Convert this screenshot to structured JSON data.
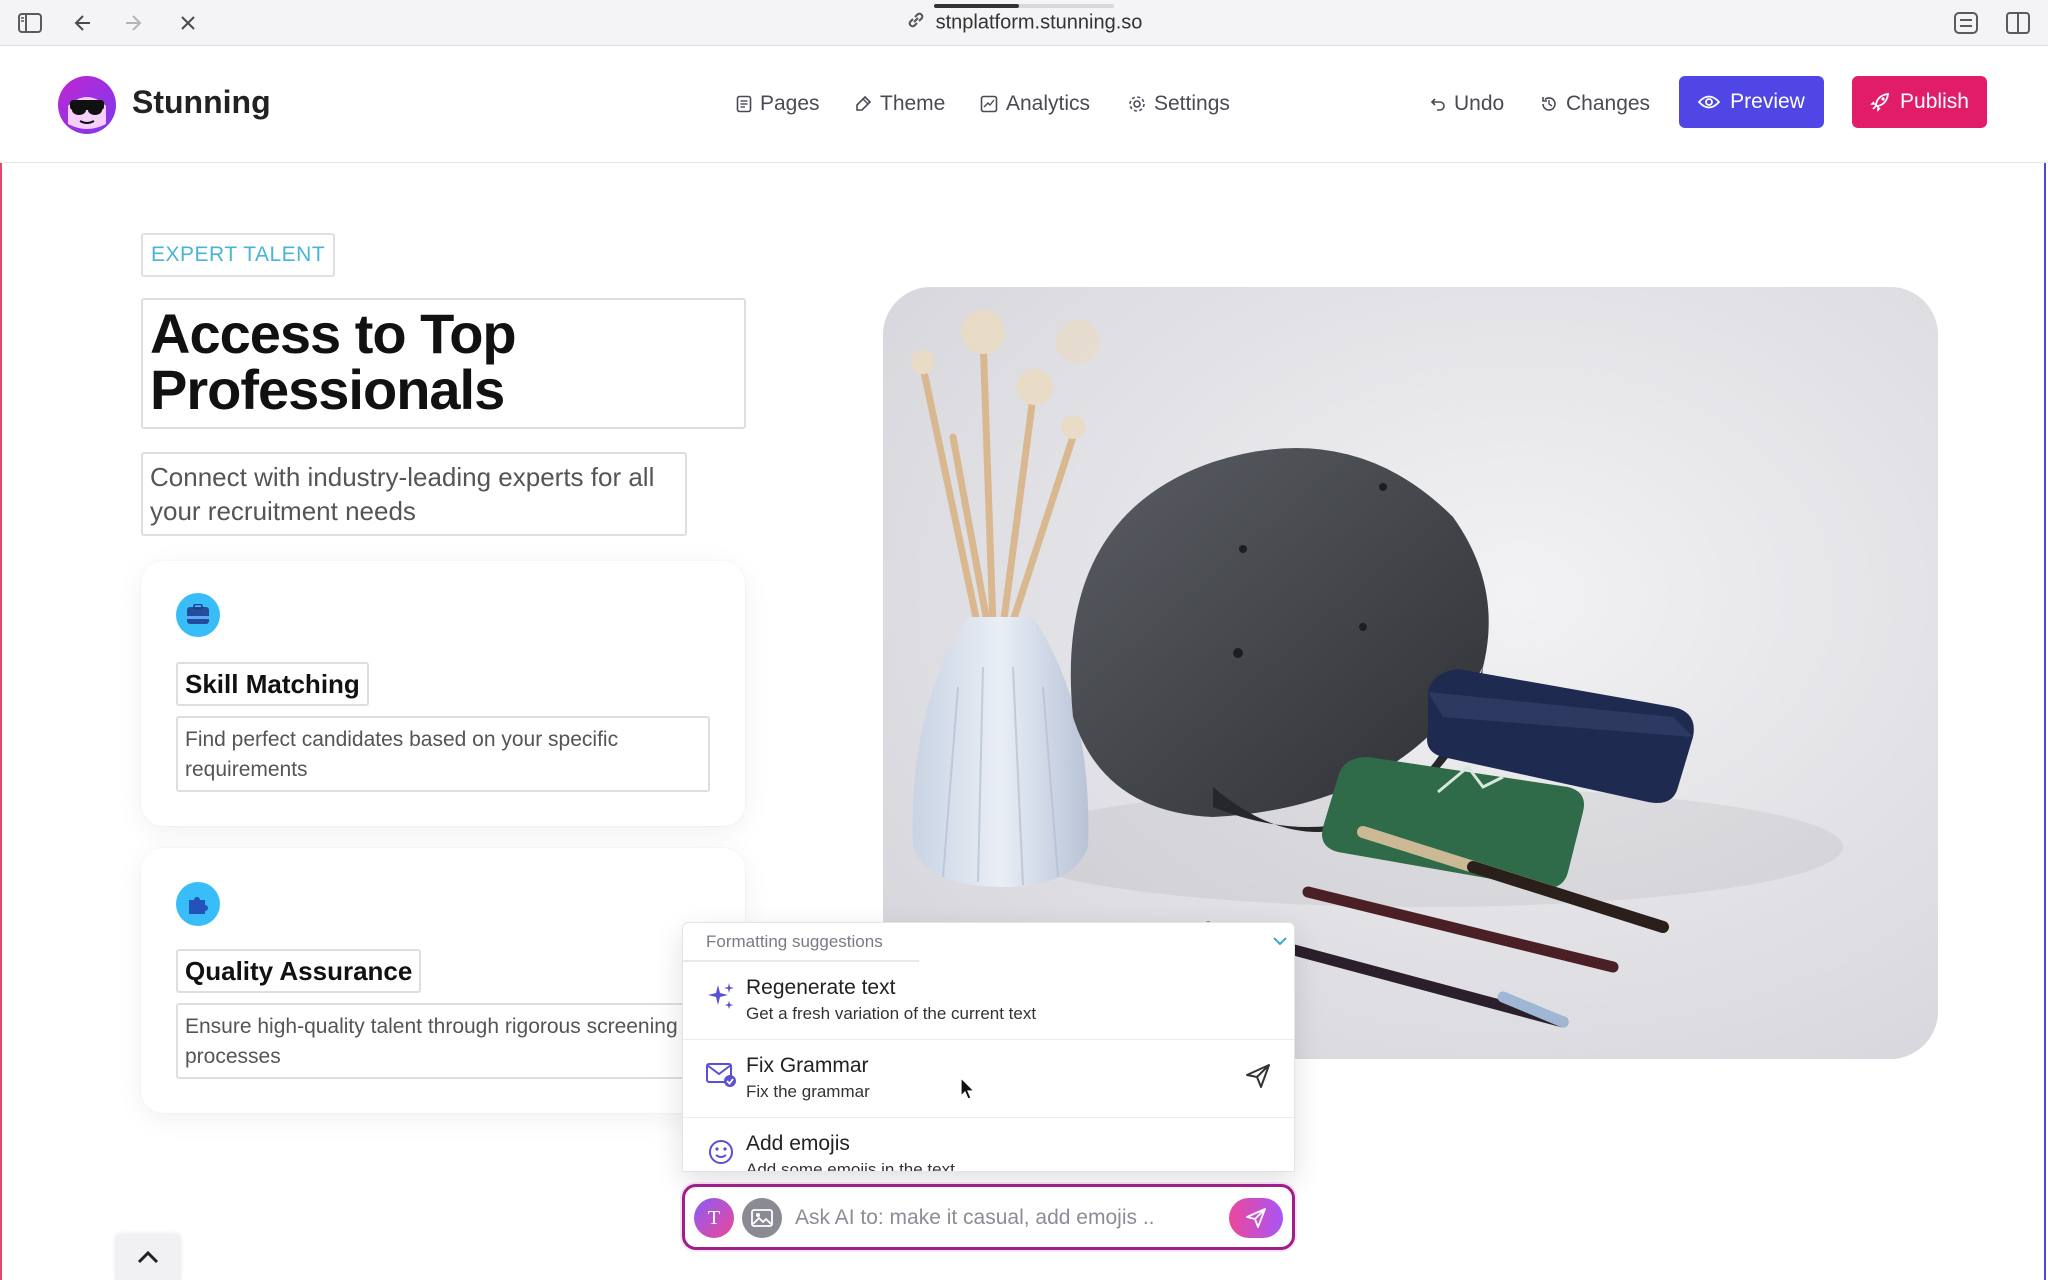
{
  "browser": {
    "url": "stnplatform.stunning.so",
    "page_load_progress": 0.47
  },
  "header": {
    "brand": "Stunning",
    "nav": [
      {
        "label": "Pages",
        "icon": "pages-icon"
      },
      {
        "label": "Theme",
        "icon": "brush-icon"
      },
      {
        "label": "Analytics",
        "icon": "chart-icon"
      },
      {
        "label": "Settings",
        "icon": "gear-icon"
      }
    ],
    "undo_label": "Undo",
    "changes_label": "Changes",
    "preview_label": "Preview",
    "publish_label": "Publish"
  },
  "hero": {
    "tag": "EXPERT TALENT",
    "headline": "Access to Top Professionals",
    "subhead": "Connect with industry-leading experts for all your recruitment needs",
    "features": [
      {
        "title": "Skill Matching",
        "description": "Find perfect candidates based on your specific requirements",
        "icon": "briefcase-icon"
      },
      {
        "title": "Quality Assurance",
        "description": "Ensure high-quality talent through rigorous screening processes",
        "icon": "puzzle-icon"
      }
    ]
  },
  "ai_panel": {
    "section_title": "Formatting suggestions",
    "suggestions": [
      {
        "title": "Regenerate text",
        "description": "Get a fresh variation of the current text",
        "icon": "sparkles-icon"
      },
      {
        "title": "Fix Grammar",
        "description": "Fix the grammar",
        "icon": "mail-check-icon"
      },
      {
        "title": "Add emojis",
        "description": "Add some emojis in the text",
        "icon": "smiley-icon"
      }
    ],
    "avatar_letter": "T",
    "placeholder": "Ask AI to: make it casual, add emojis .."
  },
  "colors": {
    "preview": "#4f46e5",
    "publish": "#e11d6a",
    "tag": "#4ab3d9",
    "feature_icon": "#38bdf8",
    "ai_border": "#a01d8c"
  }
}
